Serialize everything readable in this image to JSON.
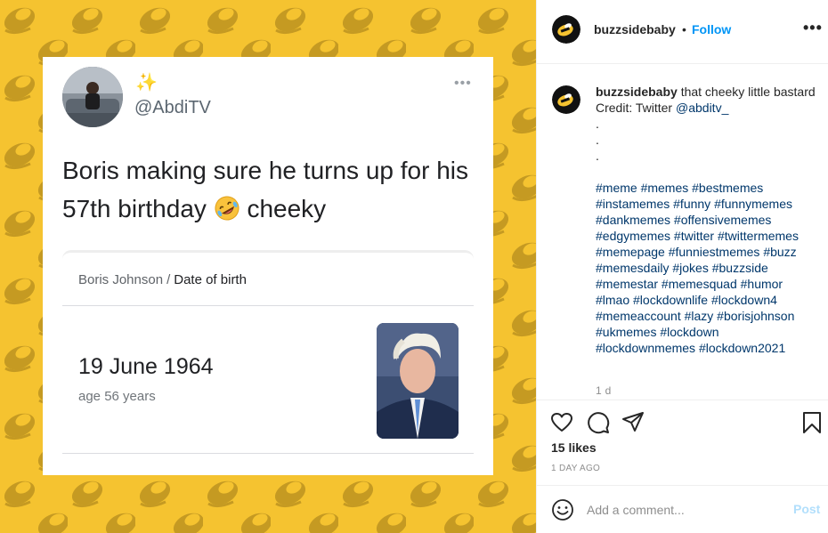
{
  "post": {
    "username": "buzzsidebaby",
    "follow_label": "Follow",
    "separator": "•",
    "more_label": "•••"
  },
  "media": {
    "tweet": {
      "sparkle": "✨",
      "handle": "@AbdiTV",
      "more": "•••",
      "text_line1": "Boris making sure he turns up for his",
      "text_line2_a": "57th birthday",
      "text_line2_b": "cheeky"
    },
    "google": {
      "breadcrumb_name": "Boris Johnson",
      "breadcrumb_sep": "/",
      "breadcrumb_current": "Date of birth",
      "date": "19 June 1964",
      "age": "age 56 years"
    }
  },
  "caption": {
    "username": "buzzsidebaby",
    "text1": "that cheeky little bastard",
    "credit_prefix": "Credit: Twitter ",
    "credit_handle": "@abditv_",
    "dots": [
      ".",
      ".",
      "."
    ],
    "hashtags": "#meme #memes #bestmemes #instamemes #funny #funnymemes #dankmemes #offensivememes #edgymemes #twitter #twittermemes #memepage #funniestmemes #buzz #memesdaily #jokes #buzzside #memestar #memesquad #humor #lmao #lockdownlife #lockdown4 #memeaccount #lazy #borisjohnson #ukmemes #lockdown #lockdownmemes #lockdown2021",
    "time": "1 d"
  },
  "actions": {
    "icons": [
      "heart-icon",
      "comment-icon",
      "share-icon",
      "bookmark-icon"
    ],
    "likes": "15 likes",
    "ago": "1 DAY AGO"
  },
  "comment": {
    "placeholder": "Add a comment...",
    "post_label": "Post"
  },
  "colors": {
    "background_yellow": "#f5c330",
    "bee_pattern": "#c59a22",
    "follow_blue": "#0095f6",
    "hashtag_blue": "#00376b",
    "post_disabled": "#b2dffc"
  }
}
